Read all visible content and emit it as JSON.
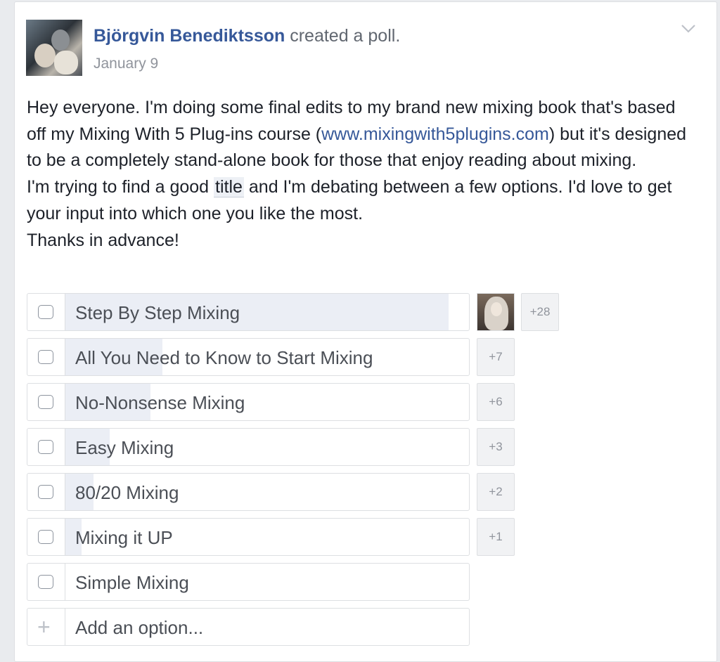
{
  "post": {
    "author": "Björgvin Benediktsson",
    "action": "created a poll.",
    "date": "January 9",
    "body_p1_a": "Hey everyone. I'm doing some final edits to my brand new mixing book that's based off my Mixing With 5 Plug-ins course (",
    "body_link": "www.mixingwith5plugins.com",
    "body_p1_b": ") but it's designed to be a completely stand-alone book for those that enjoy reading about mixing.",
    "body_p2_a": "I'm trying to find a good ",
    "body_p2_highlight": "title",
    "body_p2_b": " and I'm debating between a few options. I'd love to get your input into which one you like the most.",
    "body_p3": "Thanks in advance!"
  },
  "poll": {
    "options": [
      {
        "label": "Step By Step Mixing",
        "extra_votes": "+28",
        "share": 0.95
      },
      {
        "label": "All You Need to Know to Start Mixing",
        "extra_votes": "+7",
        "share": 0.24
      },
      {
        "label": "No-Nonsense Mixing",
        "extra_votes": "+6",
        "share": 0.21
      },
      {
        "label": "Easy Mixing",
        "extra_votes": "+3",
        "share": 0.11
      },
      {
        "label": "80/20 Mixing",
        "extra_votes": "+2",
        "share": 0.07
      },
      {
        "label": "Mixing it UP",
        "extra_votes": "+1",
        "share": 0.04
      },
      {
        "label": "Simple Mixing",
        "extra_votes": "",
        "share": 0
      }
    ],
    "add_option_placeholder": "Add an option..."
  },
  "colors": {
    "link": "#365899",
    "vote_fill": "#ebeef5",
    "border": "#dddfe2"
  },
  "icons": {
    "menu": "chevron-down-icon",
    "checkbox": "checkbox-icon",
    "add": "plus-icon"
  }
}
